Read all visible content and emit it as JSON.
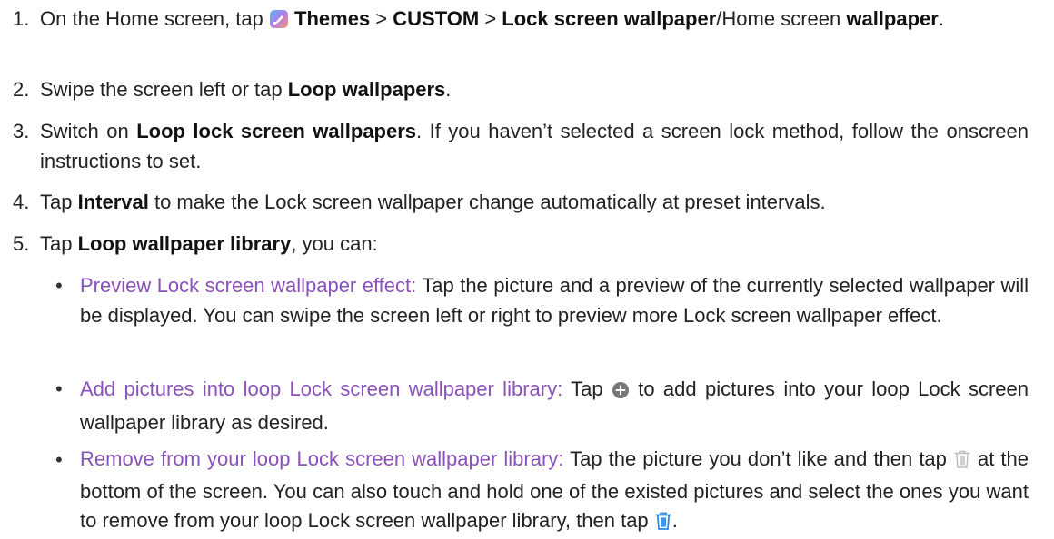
{
  "steps": [
    {
      "num": "1.",
      "parts": [
        "On the Home screen, tap ",
        "Themes",
        " > ",
        "CUSTOM",
        " > ",
        "Lock screen wallpaper",
        "/Home screen ",
        "wallpaper",
        "."
      ]
    },
    {
      "num": "2.",
      "parts": [
        "Swipe the screen left or tap ",
        "Loop wallpapers",
        "."
      ]
    },
    {
      "num": "3.",
      "parts": [
        "Switch on ",
        "Loop lock screen wallpapers",
        ". If you haven’t selected a screen lock method, follow the onscreen instructions to set."
      ]
    },
    {
      "num": "4.",
      "parts": [
        "Tap ",
        "Interval",
        " to make the Lock screen wallpaper change automatically at preset intervals."
      ]
    },
    {
      "num": "5.",
      "parts": [
        "Tap ",
        "Loop wallpaper library",
        ", you can:"
      ]
    }
  ],
  "bullets": [
    {
      "heading": "Preview Lock screen wallpaper effect:",
      "text": " Tap the picture and a preview of the currently selected wallpaper will be displayed. You can swipe the screen left or right to preview more Lock screen wallpaper effect."
    },
    {
      "heading": "Add pictures into loop Lock screen wallpaper library:",
      "text_before": " Tap ",
      "text_after": " to add pictures into your loop Lock screen wallpaper library as desired."
    },
    {
      "heading": "Remove from your loop Lock screen wallpaper library:",
      "text_before": " Tap the picture you don’t like and then tap ",
      "text_after": " at the bottom of the screen. You can also touch and hold one of the existed pictures and select the ones you want to remove from your loop Lock screen wallpaper library, then tap ",
      "text_end": "."
    }
  ],
  "bullet_symbol": "•",
  "colors": {
    "accent_purple": "#8a52b8",
    "trash_blue": "#2a8ae6",
    "add_icon_gray": "#777777"
  },
  "icons": [
    "themes-app-icon",
    "add-circle-icon",
    "trash-icon-light",
    "trash-icon-blue"
  ]
}
